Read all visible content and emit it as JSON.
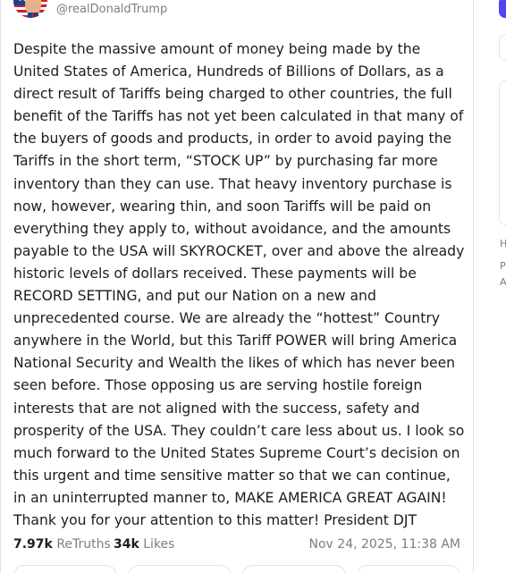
{
  "post": {
    "handle": "@realDonaldTrump",
    "body": "Despite the massive amount of money being made by the United States of America, Hundreds of Billions of Dollars, as a direct result of Tariffs being charged to other countries, the full benefit of the Tariffs has not yet been calculated in that many of the buyers of goods and products, in order to avoid paying the Tariffs in the short term, “STOCK UP” by purchasing far more inventory than they can use. That heavy inventory purchase is now, however, wearing thin, and soon Tariffs will be paid on everything they apply to, without avoidance, and the amounts payable to the USA will SKYROCKET, over and above the already historic levels of dollars received. These payments will be RECORD SETTING, and put our Nation on a new and unprecedented course. We are already the “hottest” Country anywhere in the World, but this Tariff POWER will bring America National Security and Wealth the likes of which has never been seen before. Those opposing us are serving hostile foreign interests that are not aligned with the success, safety and prosperity of the USA. They couldn’t care less about us. I look so much forward to the United States Supreme Court’s decision on this urgent and time sensitive matter so that we can continue, in an uninterrupted manner to, MAKE AMERICA GREAT AGAIN! Thank you for your attention to this matter! President DJT",
    "retruths_count": "7.97k",
    "retruths_label": "ReTruths",
    "likes_count": "34k",
    "likes_label": "Likes",
    "timestamp": "Nov 24, 2025, 11:38 AM"
  },
  "right_rail": {
    "text_1": "H",
    "text_2": "P",
    "text_3": "A"
  },
  "colors": {
    "accent": "#5145f0",
    "muted_text": "#7a7d86",
    "border": "#e3e4e8"
  },
  "icons": {
    "avatar": "american-flag-avatar"
  }
}
